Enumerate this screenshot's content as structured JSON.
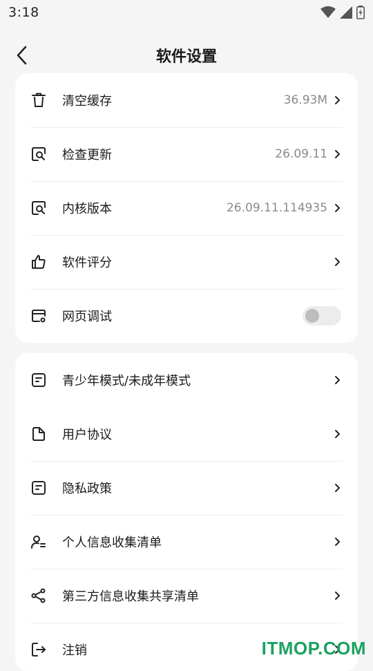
{
  "status": {
    "time": "3:18"
  },
  "header": {
    "title": "软件设置"
  },
  "card1": {
    "items": [
      {
        "label": "清空缓存",
        "value": "36.93M",
        "icon": "trash-icon"
      },
      {
        "label": "检查更新",
        "value": "26.09.11",
        "icon": "search-doc-icon"
      },
      {
        "label": "内核版本",
        "value": "26.09.11.114935",
        "icon": "search-doc-icon"
      },
      {
        "label": "软件评分",
        "value": "",
        "icon": "thumbs-up-icon"
      },
      {
        "label": "网页调试",
        "value": "",
        "icon": "browser-settings-icon",
        "toggle": false
      }
    ]
  },
  "card2": {
    "items": [
      {
        "label": "青少年模式/未成年模式",
        "icon": "note-icon"
      },
      {
        "label": "用户协议",
        "icon": "document-icon"
      },
      {
        "label": "隐私政策",
        "icon": "note-icon"
      },
      {
        "label": "个人信息收集清单",
        "icon": "person-list-icon"
      },
      {
        "label": "第三方信息收集共享清单",
        "icon": "share-icon"
      },
      {
        "label": "注销",
        "icon": "logout-icon"
      }
    ]
  },
  "watermark": "ITMOP.COM"
}
